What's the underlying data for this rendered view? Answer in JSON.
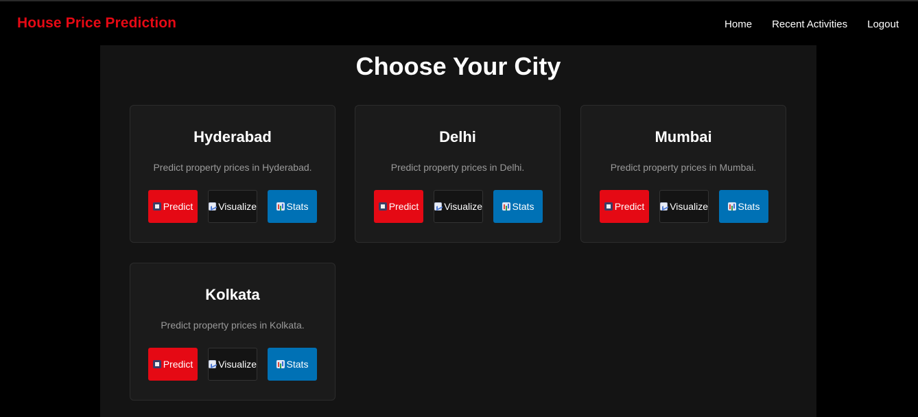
{
  "header": {
    "brand": "House Price Prediction",
    "nav": [
      "Home",
      "Recent Activities",
      "Logout"
    ]
  },
  "main": {
    "title": "Choose Your City",
    "cities": [
      {
        "name": "Hyderabad",
        "desc": "Predict property prices in Hyderabad.",
        "predict": "Predict",
        "visualize": "Visualize",
        "stats": "Stats"
      },
      {
        "name": "Delhi",
        "desc": "Predict property prices in Delhi.",
        "predict": "Predict",
        "visualize": "Visualize",
        "stats": "Stats"
      },
      {
        "name": "Mumbai",
        "desc": "Predict property prices in Mumbai.",
        "predict": "Predict",
        "visualize": "Visualize",
        "stats": "Stats"
      },
      {
        "name": "Kolkata",
        "desc": "Predict property prices in Kolkata.",
        "predict": "Predict",
        "visualize": "Visualize",
        "stats": "Stats"
      }
    ]
  },
  "icons": {
    "predict": "house-icon",
    "visualize": "line-chart-icon",
    "stats": "bar-chart-icon"
  },
  "colors": {
    "brand": "#e50914",
    "predict_button": "#e50914",
    "stats_button": "#0071b5",
    "background": "#000000",
    "panel": "#141414"
  }
}
